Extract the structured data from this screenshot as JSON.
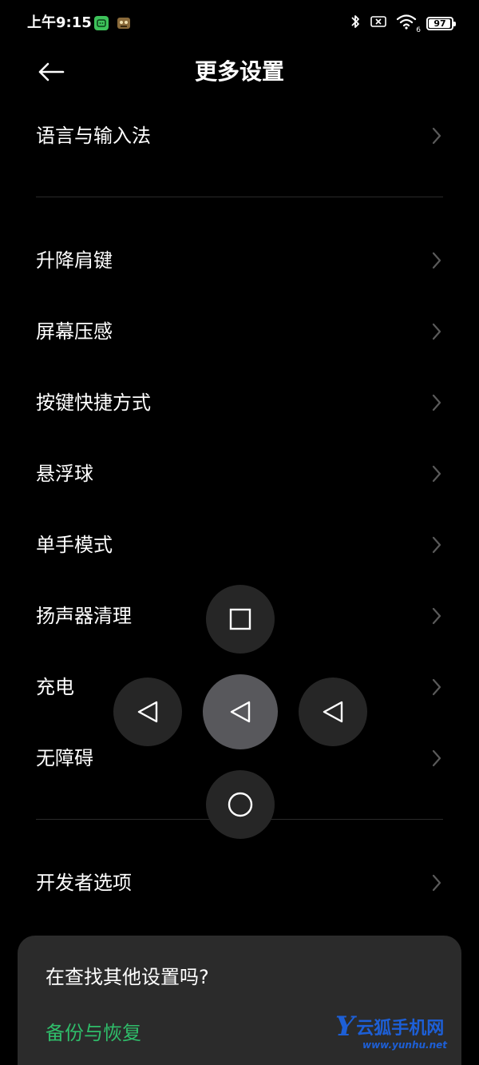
{
  "status_bar": {
    "time": "上午9:15",
    "battery_level": "97",
    "battery_fraction": 0.97,
    "icons": [
      "wechat-app-icon",
      "game-app-icon",
      "bluetooth-icon",
      "sim-off-icon",
      "wifi-icon",
      "battery-icon"
    ],
    "wifi_badge": "6"
  },
  "header": {
    "back_icon": "arrow-left-icon",
    "title": "更多设置"
  },
  "settings": {
    "items": [
      {
        "label": "语言与输入法"
      },
      {
        "label": "升降肩键"
      },
      {
        "label": "屏幕压感"
      },
      {
        "label": "按键快捷方式"
      },
      {
        "label": "悬浮球"
      },
      {
        "label": "单手模式"
      },
      {
        "label": "扬声器清理"
      },
      {
        "label": "充电"
      },
      {
        "label": "无障碍"
      },
      {
        "label": "开发者选项"
      }
    ],
    "chevron_icon": "chevron-right-icon"
  },
  "floating_ball": {
    "buttons": [
      "recents-square-icon",
      "back-triangle-icon",
      "back-triangle-icon",
      "back-triangle-icon",
      "home-circle-icon"
    ]
  },
  "bottom_card": {
    "title": "在查找其他设置吗?",
    "link": "备份与恢复"
  },
  "watermark": {
    "logo": "Y",
    "brand": "云狐手机网",
    "url": "www.yunhu.net"
  },
  "colors": {
    "background": "#000000",
    "text": "#ffffff",
    "chevron": "#5a5a5a",
    "divider": "#2a2a2a",
    "card": "#2b2b2b",
    "accent_green": "#2fbd6a",
    "float_button": "#262626",
    "float_center": "#58585c",
    "watermark_blue": "#1d5fd6"
  }
}
